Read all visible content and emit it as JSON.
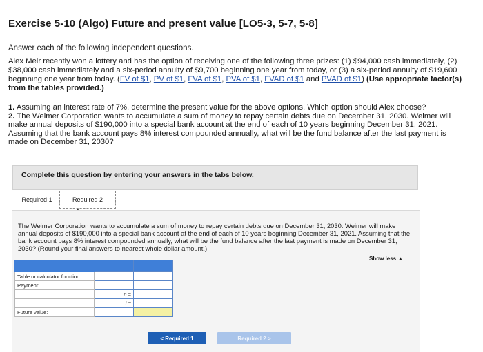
{
  "header": {
    "title": "Exercise 5-10 (Algo) Future and present value [LO5-3, 5-7, 5-8]",
    "intro": "Answer each of the following independent questions."
  },
  "problem": {
    "text_1": "Alex Meir recently won a lottery and has the option of receiving one of the following three prizes: (1) $94,000 cash immediately, (2) $38,000 cash immediately and a six-period annuity of $9,700 beginning one year from today, or (3) a six-period annuity of $19,600 beginning one year from today. (",
    "links": [
      "FV of $1",
      "PV of $1",
      "FVA of $1",
      "PVA of $1",
      "FVAD of $1",
      "PVAD of $1"
    ],
    "sep_comma": ", ",
    "sep_and": " and ",
    "text_2": ") ",
    "bold_tail": "(Use appropriate factor(s) from the tables provided.)"
  },
  "questions": {
    "q1_num": "1.",
    "q1_text": " Assuming an interest rate of 7%, determine the present value for the above options. Which option should Alex choose?",
    "q2_num": "2.",
    "q2_text": " The Weimer Corporation wants to accumulate a sum of money to repay certain debts due on December 31, 2030. Weimer will make annual deposits of $190,000 into a special bank account at the end of each of 10 years beginning December 31, 2021. Assuming that the bank account pays 8% interest compounded annually, what will be the fund balance after the last payment is made on December 31, 2030?"
  },
  "banner": {
    "text": "Complete this question by entering your answers in the tabs below."
  },
  "tabs": [
    {
      "label": "Required 1"
    },
    {
      "label": "Required 2"
    }
  ],
  "panel": {
    "text": "The Weimer Corporation wants to accumulate a sum of money to repay certain debts due on December 31, 2030. Weimer will make annual deposits of $190,000 into a special bank account at the end of each of 10 years beginning December 31, 2021. Assuming that the bank account pays 8% interest compounded annually, what will be the fund balance after the last payment is made on December 31, 2030? (Round your final answers to nearest whole dollar amount.)",
    "show_less": "Show less ▲"
  },
  "calc_table": {
    "row_factor": "Table or calculator function:",
    "row_payment": "Payment:",
    "row_n": "n =",
    "row_i": "i =",
    "row_future": "Future value:"
  },
  "nav": {
    "prev_label": "< Required 1",
    "next_label": "Required 2 >"
  },
  "colors": {
    "accent": "#1e5fb5",
    "table_header": "#3f7fd8",
    "highlight_input": "#f4f1a4",
    "link": "#1f4fa8"
  }
}
